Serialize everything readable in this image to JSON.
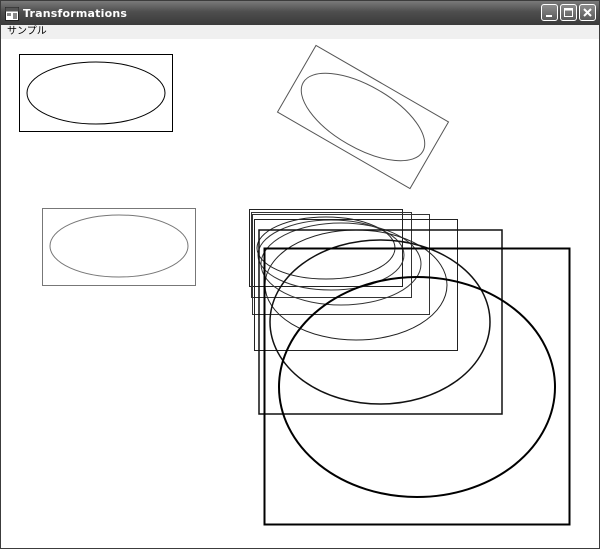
{
  "window": {
    "title": "Transformations",
    "icon": "app-window-icon",
    "controls": [
      {
        "name": "minimize-button",
        "icon": "minimize-icon"
      },
      {
        "name": "maximize-button",
        "icon": "maximize-icon"
      },
      {
        "name": "close-button",
        "icon": "close-icon"
      }
    ]
  },
  "menu": {
    "items": [
      {
        "label": "サンプル"
      }
    ]
  },
  "colors": {
    "titlebar": "#4e4e4e",
    "stroke": "#000000",
    "background": "#ffffff"
  }
}
